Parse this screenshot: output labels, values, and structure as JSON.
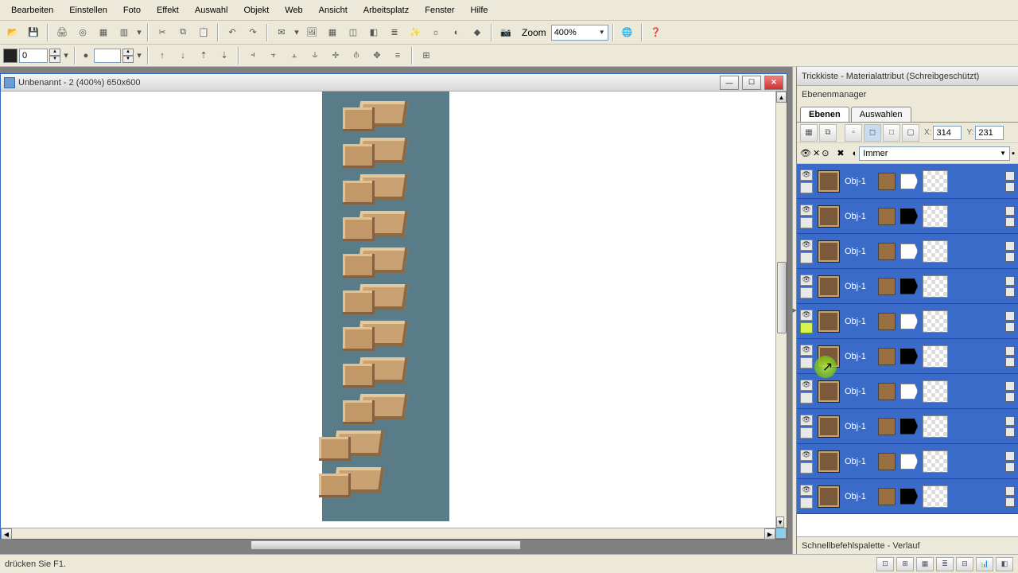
{
  "menu": {
    "items": [
      "Bearbeiten",
      "Einstellen",
      "Foto",
      "Effekt",
      "Auswahl",
      "Objekt",
      "Web",
      "Ansicht",
      "Arbeitsplatz",
      "Fenster",
      "Hilfe"
    ]
  },
  "toolbar": {
    "zoom_label": "Zoom",
    "zoom_value": "400%"
  },
  "options": {
    "offset": "0"
  },
  "document": {
    "title": "Unbenannt - 2 (400%) 650x600"
  },
  "side": {
    "trickkiste_title": "Trickkiste - Materialattribut (Schreibgeschützt)",
    "ebenenmanager_title": "Ebenenmanager",
    "tab_ebenen": "Ebenen",
    "tab_auswahlen": "Auswahlen",
    "x_label": "X:",
    "x_val": "314",
    "y_label": "Y:",
    "y_val": "231",
    "blend_mode": "Immer",
    "schnell_title": "Schnellbefehlspalette - Verlauf"
  },
  "layers": [
    {
      "name": "Obj-1",
      "flag": "white"
    },
    {
      "name": "Obj-1",
      "flag": "black"
    },
    {
      "name": "Obj-1",
      "flag": "white"
    },
    {
      "name": "Obj-1",
      "flag": "black"
    },
    {
      "name": "Obj-1",
      "flag": "white",
      "highlight": true
    },
    {
      "name": "Obj-1",
      "flag": "black"
    },
    {
      "name": "Obj-1",
      "flag": "white"
    },
    {
      "name": "Obj-1",
      "flag": "black"
    },
    {
      "name": "Obj-1",
      "flag": "white"
    },
    {
      "name": "Obj-1",
      "flag": "black"
    }
  ],
  "status": {
    "text": "drücken Sie F1."
  }
}
